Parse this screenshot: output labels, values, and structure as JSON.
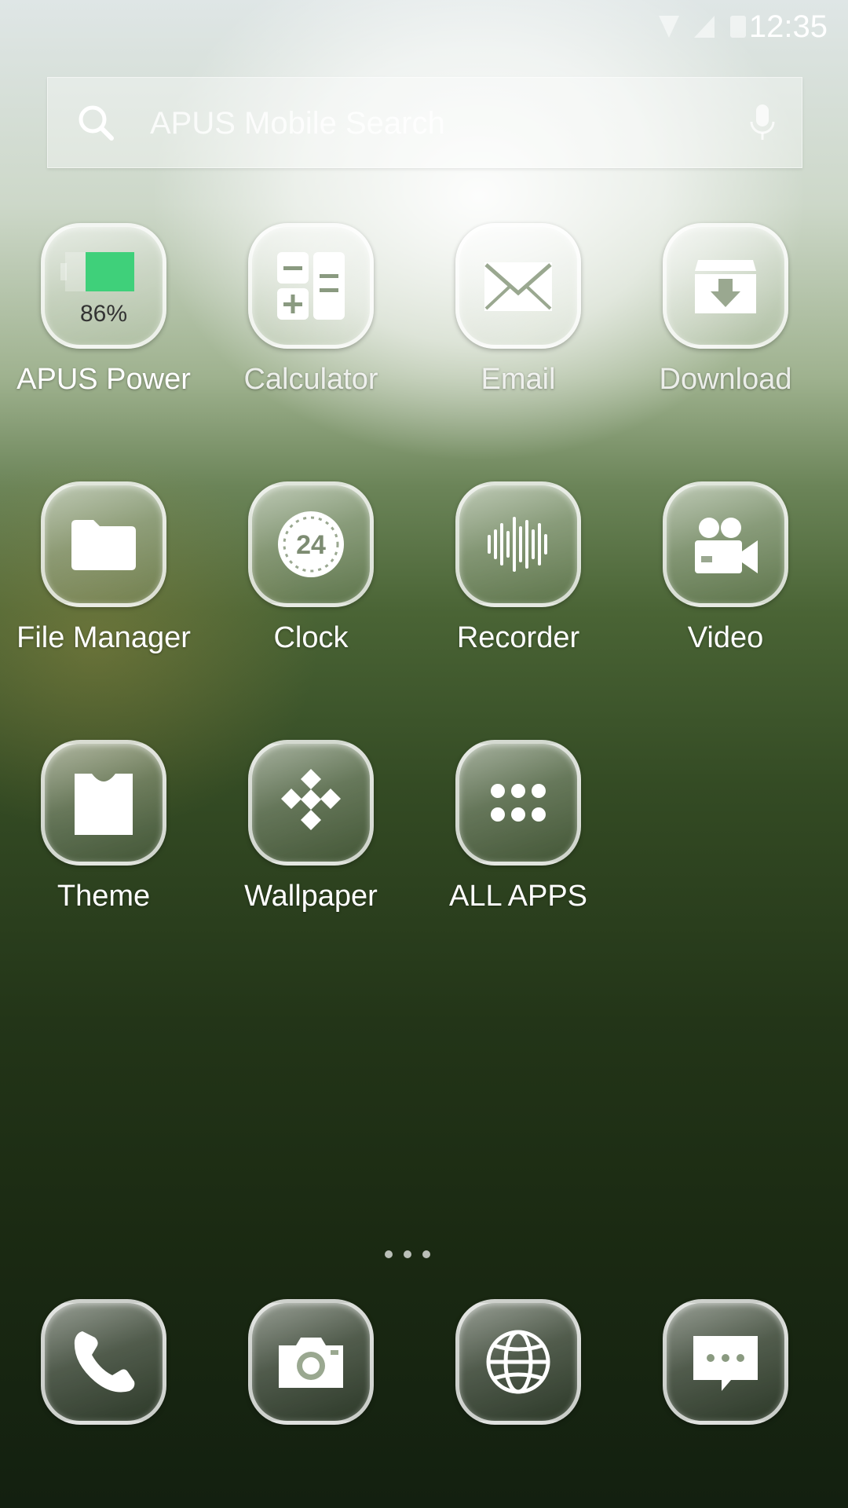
{
  "status_bar": {
    "time": "12:35"
  },
  "search": {
    "placeholder": "APUS Mobile Search"
  },
  "apps": [
    {
      "label": "APUS Power",
      "icon": "battery-icon",
      "battery_level": "86%"
    },
    {
      "label": "Calculator",
      "icon": "calculator-icon"
    },
    {
      "label": "Email",
      "icon": "envelope-icon"
    },
    {
      "label": "Download",
      "icon": "download-box-icon"
    },
    {
      "label": "File Manager",
      "icon": "folder-icon"
    },
    {
      "label": "Clock",
      "icon": "clock-24-icon",
      "clock_text": "24"
    },
    {
      "label": "Recorder",
      "icon": "waveform-icon"
    },
    {
      "label": "Video",
      "icon": "video-camera-icon"
    },
    {
      "label": "Theme",
      "icon": "shirt-icon"
    },
    {
      "label": "Wallpaper",
      "icon": "diamond-tiles-icon"
    },
    {
      "label": "ALL APPS",
      "icon": "app-grid-icon"
    }
  ],
  "dock": [
    {
      "name": "phone",
      "icon": "phone-icon"
    },
    {
      "name": "camera",
      "icon": "camera-icon"
    },
    {
      "name": "browser",
      "icon": "globe-icon"
    },
    {
      "name": "messages",
      "icon": "message-icon"
    }
  ],
  "colors": {
    "battery_fill": "#3fd07a"
  }
}
